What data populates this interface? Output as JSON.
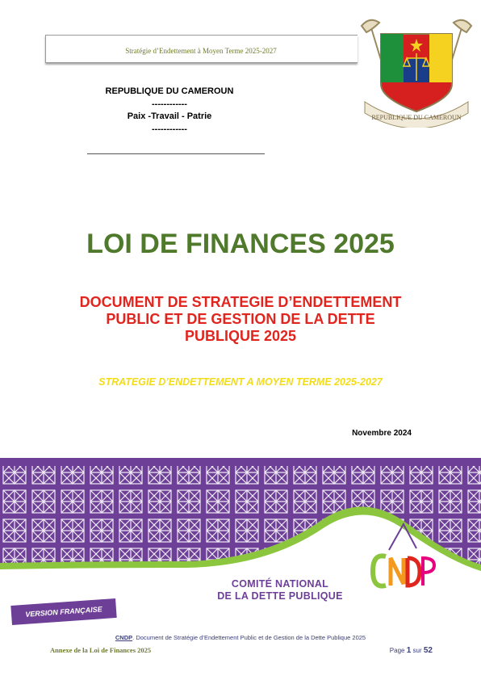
{
  "header": {
    "running_title": "Stratégie d’Endettement à Moyen Terme 2025-2027"
  },
  "emblem": {
    "motto_text": "REPUBLIQUE DU CAMEROUN",
    "colors": {
      "green": "#1e8f3a",
      "red": "#d62020",
      "yellow": "#f4d21f"
    }
  },
  "republic": {
    "name": "REPUBLIQUE DU CAMEROUN",
    "separator1": "------------",
    "motto": "Paix -Travail - Patrie",
    "separator2": "------------"
  },
  "title": "LOI DE FINANCES 2025",
  "subtitle": {
    "line1": "DOCUMENT DE STRATEGIE D’ENDETTEMENT",
    "line2": "PUBLIC ET DE GESTION DE LA DETTE",
    "line3": "PUBLIQUE 2025"
  },
  "strategy": "STRATEGIE D’ENDETTEMENT A MOYEN TERME 2025-2027",
  "date": "Novembre  2024",
  "banner": {
    "org_line1": "COMITÉ NATIONAL",
    "org_line2": "DE LA DETTE PUBLIQUE",
    "logo_text": "CNDP",
    "version_label": "VERSION FRANÇAISE",
    "colors": {
      "purple": "#6d3f97",
      "green": "#8cc63f",
      "orange": "#f39a1e",
      "red": "#e0251e",
      "pink": "#e6007e"
    }
  },
  "footer": {
    "doc_prefix": "CNDP",
    "doc_text": ". Document de Stratégie d’Endettement Public et de Gestion de la Dette Publique 2025",
    "annex": "Annexe de la Loi de Finances 2025",
    "page_word": "Page",
    "page_number": "1",
    "of_word": "sur",
    "total_pages": "52"
  }
}
